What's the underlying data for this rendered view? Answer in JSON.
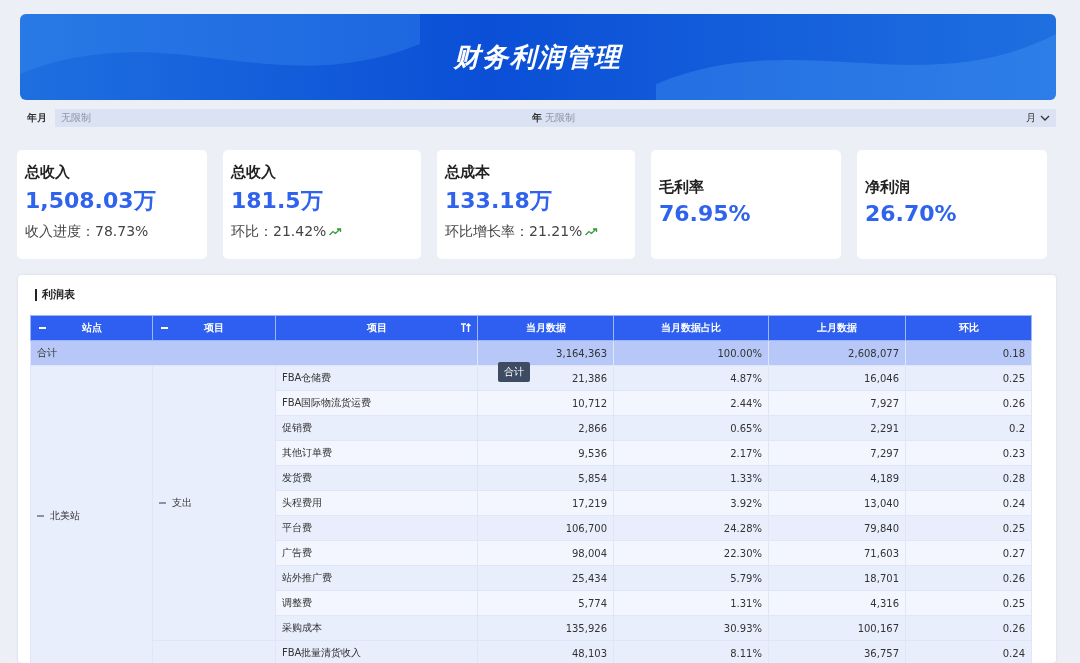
{
  "title": "财务利润管理",
  "filter": {
    "label": "年月",
    "placeholder": "无限制",
    "year_label": "年",
    "year_placeholder": "无限制",
    "month_label": "月"
  },
  "kpis": [
    {
      "title": "总收入",
      "value": "1,508.03万",
      "note": "收入进度：78.73%",
      "trend_up": false
    },
    {
      "title": "总收入",
      "value": "181.5万",
      "note": "环比：21.42%",
      "trend_up": true
    },
    {
      "title": "总成本",
      "value": "133.18万",
      "note": "环比增长率：21.21%",
      "trend_up": true
    },
    {
      "title": "毛利率",
      "value": "76.95%"
    },
    {
      "title": "净利润",
      "value": "26.70%"
    }
  ],
  "table": {
    "title": "利润表",
    "columns": [
      {
        "label": "站点",
        "collapsible": true,
        "sortable": false
      },
      {
        "label": "项目",
        "collapsible": true,
        "sortable": false
      },
      {
        "label": "项目",
        "collapsible": false,
        "sortable": true
      },
      {
        "label": "当月数据",
        "collapsible": false,
        "sortable": false
      },
      {
        "label": "当月数据占比",
        "collapsible": false,
        "sortable": false
      },
      {
        "label": "上月数据",
        "collapsible": false,
        "sortable": false
      },
      {
        "label": "环比",
        "collapsible": false,
        "sortable": false
      }
    ],
    "total_row": {
      "label": "合计",
      "values": [
        "3,164,363",
        "100.00%",
        "2,608,077",
        "0.18"
      ]
    },
    "tooltip": "合计",
    "groups": [
      {
        "site": "北美站",
        "expanded": true,
        "sections": [
          {
            "name": "支出",
            "expanded": true,
            "rows": [
              {
                "item": "FBA仓储费",
                "values": [
                  "21,386",
                  "4.87%",
                  "16,046",
                  "0.25"
                ]
              },
              {
                "item": "FBA国际物流货运费",
                "values": [
                  "10,712",
                  "2.44%",
                  "7,927",
                  "0.26"
                ]
              },
              {
                "item": "促销费",
                "values": [
                  "2,866",
                  "0.65%",
                  "2,291",
                  "0.2"
                ]
              },
              {
                "item": "其他订单费",
                "values": [
                  "9,536",
                  "2.17%",
                  "7,297",
                  "0.23"
                ]
              },
              {
                "item": "发货费",
                "values": [
                  "5,854",
                  "1.33%",
                  "4,189",
                  "0.28"
                ]
              },
              {
                "item": "头程费用",
                "values": [
                  "17,219",
                  "3.92%",
                  "13,040",
                  "0.24"
                ]
              },
              {
                "item": "平台费",
                "values": [
                  "106,700",
                  "24.28%",
                  "79,840",
                  "0.25"
                ]
              },
              {
                "item": "广告费",
                "values": [
                  "98,004",
                  "22.30%",
                  "71,603",
                  "0.27"
                ]
              },
              {
                "item": "站外推广费",
                "values": [
                  "25,434",
                  "5.79%",
                  "18,701",
                  "0.26"
                ]
              },
              {
                "item": "调整费",
                "values": [
                  "5,774",
                  "1.31%",
                  "4,316",
                  "0.25"
                ]
              },
              {
                "item": "采购成本",
                "values": [
                  "135,926",
                  "30.93%",
                  "100,167",
                  "0.26"
                ]
              }
            ]
          },
          {
            "rows": [
              {
                "item": "FBA批量清货收入",
                "values": [
                  "48,103",
                  "8.11%",
                  "36,757",
                  "0.24"
                ]
              }
            ]
          }
        ]
      }
    ]
  }
}
